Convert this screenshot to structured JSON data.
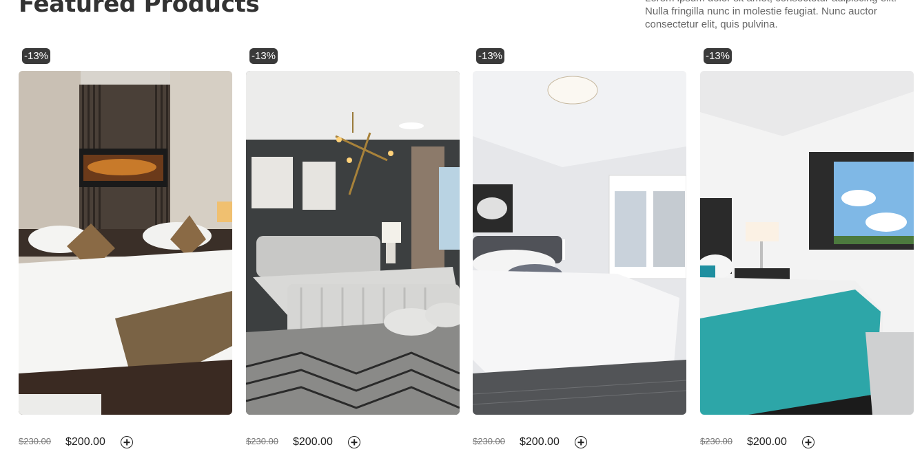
{
  "section": {
    "title": "Featured Products",
    "description": "Lorem ipsum dolor sit amet, consectetur adipiscing elit. Nulla fringilla nunc in molestie feugiat. Nunc auctor consectetur elit, quis pulvina."
  },
  "products": [
    {
      "badge": "-13%",
      "old_price": "$230.00",
      "price": "$200.00",
      "image_icon": "bedroom-photo-brown-bed"
    },
    {
      "badge": "-13%",
      "old_price": "$230.00",
      "price": "$200.00",
      "image_icon": "bedroom-photo-grey-tufted-bed"
    },
    {
      "badge": "-13%",
      "old_price": "$230.00",
      "price": "$200.00",
      "image_icon": "bedroom-photo-white-bed"
    },
    {
      "badge": "-13%",
      "old_price": "$230.00",
      "price": "$200.00",
      "image_icon": "bedroom-photo-teal-bed"
    }
  ],
  "colors": {
    "badge_bg": "#3a3a3a",
    "text": "#333333"
  }
}
